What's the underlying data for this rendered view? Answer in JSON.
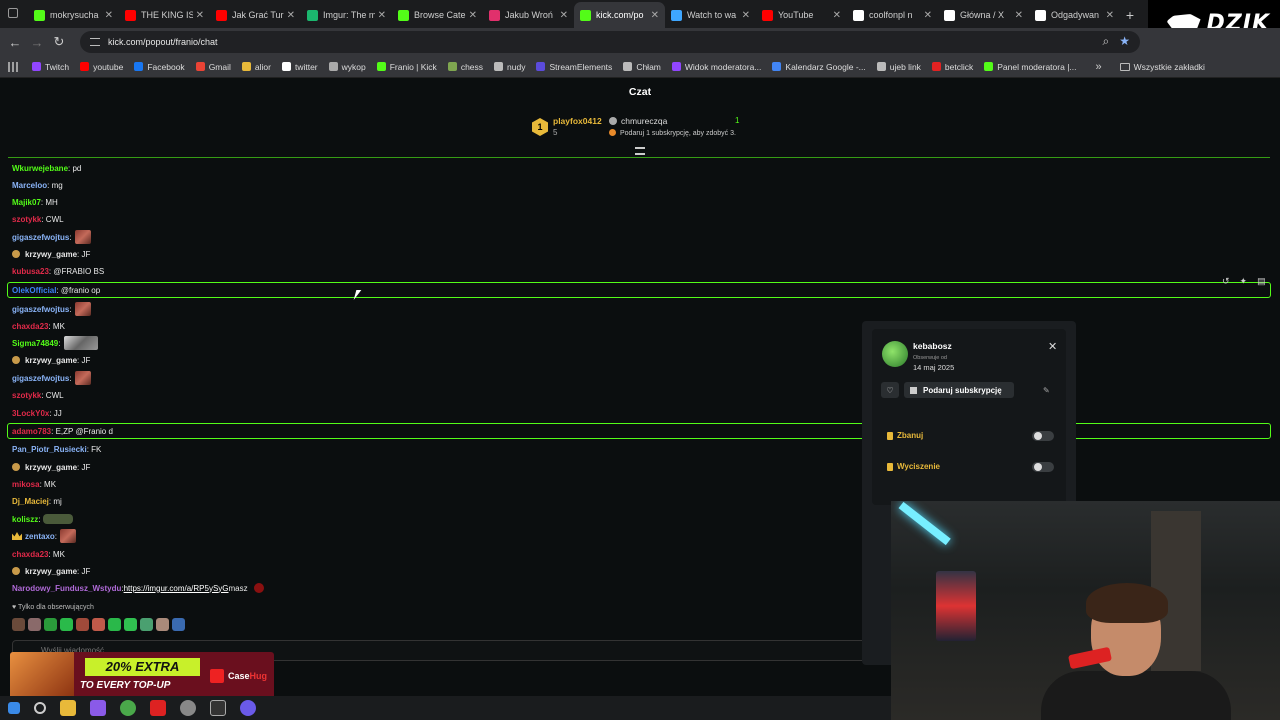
{
  "tabs": [
    {
      "title": "mokrysucha",
      "color": "#53fc18",
      "active": false
    },
    {
      "title": "THE KING IS",
      "color": "#ff0000",
      "active": false
    },
    {
      "title": "Jak Grać Tur",
      "color": "#ff0000",
      "active": false
    },
    {
      "title": "Imgur: The m",
      "color": "#1bb76e",
      "active": false
    },
    {
      "title": "Browse Cate",
      "color": "#53fc18",
      "active": false
    },
    {
      "title": "Jakub Wroń",
      "color": "#e1306c",
      "active": false
    },
    {
      "title": "kick.com/po",
      "color": "#53fc18",
      "active": true
    },
    {
      "title": "Watch to wa",
      "color": "#3ea6ff",
      "active": false
    },
    {
      "title": "YouTube",
      "color": "#ff0000",
      "active": false
    },
    {
      "title": "coolfonpl n",
      "color": "#ffffff",
      "active": false
    },
    {
      "title": "Główna / X",
      "color": "#ffffff",
      "active": false
    },
    {
      "title": "Odgadywan",
      "color": "#ffffff",
      "active": false
    }
  ],
  "overlay_logo": "DZIK",
  "address": {
    "url": "kick.com/popout/franio/chat"
  },
  "bookmarks": [
    {
      "label": "Twitch",
      "color": "#9146ff"
    },
    {
      "label": "youtube",
      "color": "#ff0000"
    },
    {
      "label": "Facebook",
      "color": "#1877f2"
    },
    {
      "label": "Gmail",
      "color": "#ea4335"
    },
    {
      "label": "alior",
      "color": "#e8b93a"
    },
    {
      "label": "twitter",
      "color": "#ffffff"
    },
    {
      "label": "wykop",
      "color": "#aaaaaa"
    },
    {
      "label": "Franio | Kick",
      "color": "#53fc18"
    },
    {
      "label": "chess",
      "color": "#7fa650"
    },
    {
      "label": "nudy",
      "color": "#bbbbbb"
    },
    {
      "label": "StreamElements",
      "color": "#5b4bdb"
    },
    {
      "label": "Chłam",
      "color": "#bbbbbb"
    },
    {
      "label": "Widok moderatora...",
      "color": "#9146ff"
    },
    {
      "label": "Kalendarz Google -...",
      "color": "#4285f4"
    },
    {
      "label": "ujeb link",
      "color": "#bbbbbb"
    },
    {
      "label": "betclick",
      "color": "#e22222"
    },
    {
      "label": "Panel moderatora |...",
      "color": "#53fc18"
    }
  ],
  "bookmarks_all": "Wszystkie zakładki",
  "chat": {
    "title": "Czat",
    "top_gifter": {
      "rank": "1",
      "name": "playfox0412",
      "count": "5"
    },
    "gift_goal": {
      "name": "chmureczqa",
      "count": "1",
      "text": "Podaruj 1 subskrypcję, aby zdobyć 3."
    },
    "follow_only": "Tylko dla obserwujących",
    "input_placeholder": "Wyślij wiadomość"
  },
  "messages": [
    {
      "user": "Wkurwejebane",
      "color": "#53fc18",
      "text": ": pd"
    },
    {
      "user": "Marceloo",
      "color": "#8ab4f8",
      "text": ": mg"
    },
    {
      "user": "Majik07",
      "color": "#53fc18",
      "text": ": MH"
    },
    {
      "user": "szotykk",
      "color": "#e22a4a",
      "text": ": CWL"
    },
    {
      "user": "gigaszefwojtus",
      "color": "#8ab4f8",
      "text": ":",
      "emote": true
    },
    {
      "user": "krzywy_game",
      "color": "#e8e8e8",
      "text": ": JF",
      "sub": true
    },
    {
      "user": "kubusa23",
      "color": "#e22a4a",
      "text": ": @FRABIO BS"
    },
    {
      "user": "OlekOfficial",
      "color": "#3b82f6",
      "text": ": @franio op"
    },
    {
      "user": "gigaszefwojtus",
      "color": "#8ab4f8",
      "text": ":",
      "emote": true
    },
    {
      "user": "chaxda23",
      "color": "#e22a4a",
      "text": ": MK"
    },
    {
      "user": "Sigma74849",
      "color": "#53fc18",
      "text": ":",
      "emote_wide": true
    },
    {
      "user": "krzywy_game",
      "color": "#e8e8e8",
      "text": ": JF",
      "sub": true
    },
    {
      "user": "gigaszefwojtus",
      "color": "#8ab4f8",
      "text": ":",
      "emote": true
    },
    {
      "user": "szotykk",
      "color": "#e22a4a",
      "text": ": CWL"
    },
    {
      "user": "3LockY0x",
      "color": "#e22a4a",
      "text": ": JJ"
    },
    {
      "user": "adamo783",
      "color": "#e22a4a",
      "text": ": E,ZP @Franio d"
    },
    {
      "user": "Pan_Piotr_Rusiecki",
      "color": "#8ab4f8",
      "text": ": FK"
    },
    {
      "user": "krzywy_game",
      "color": "#e8e8e8",
      "text": ": JF",
      "sub": true
    },
    {
      "user": "mikosa",
      "color": "#e22a4a",
      "text": ": MK"
    },
    {
      "user": "Dj_Maciej",
      "color": "#e8b93a",
      "text": ": mj"
    },
    {
      "user": "koliszz",
      "color": "#53fc18",
      "text": ":",
      "emote_tank": true
    },
    {
      "user": "zentaxo",
      "color": "#8ab4f8",
      "text": ":",
      "emote": true,
      "crown": true
    },
    {
      "user": "chaxda23",
      "color": "#e22a4a",
      "text": ": MK"
    },
    {
      "user": "krzywy_game",
      "color": "#e8e8e8",
      "text": ": JF",
      "sub": true
    },
    {
      "user": "Narodowy_Fundusz_Wstydu",
      "color": "#b06ad8",
      "text": ": ",
      "link": "https://imgur.com/a/RP5ySyG",
      "after": " masz"
    }
  ],
  "user_card": {
    "name": "kebabosz",
    "followed_label": "Obserwuje od",
    "followed_date": "14 maj 2025",
    "gift_label": "Podaruj subskrypcję",
    "ban_label": "Zbanuj",
    "mute_label": "Wyciszenie"
  },
  "promo": {
    "headline": "20% EXTRA",
    "sub": "TO EVERY TOP-UP",
    "brand": "Case",
    "brand_accent": "Hug"
  },
  "colors": {
    "kick_green": "#53fc18",
    "accent_gold": "#e8b93a"
  }
}
